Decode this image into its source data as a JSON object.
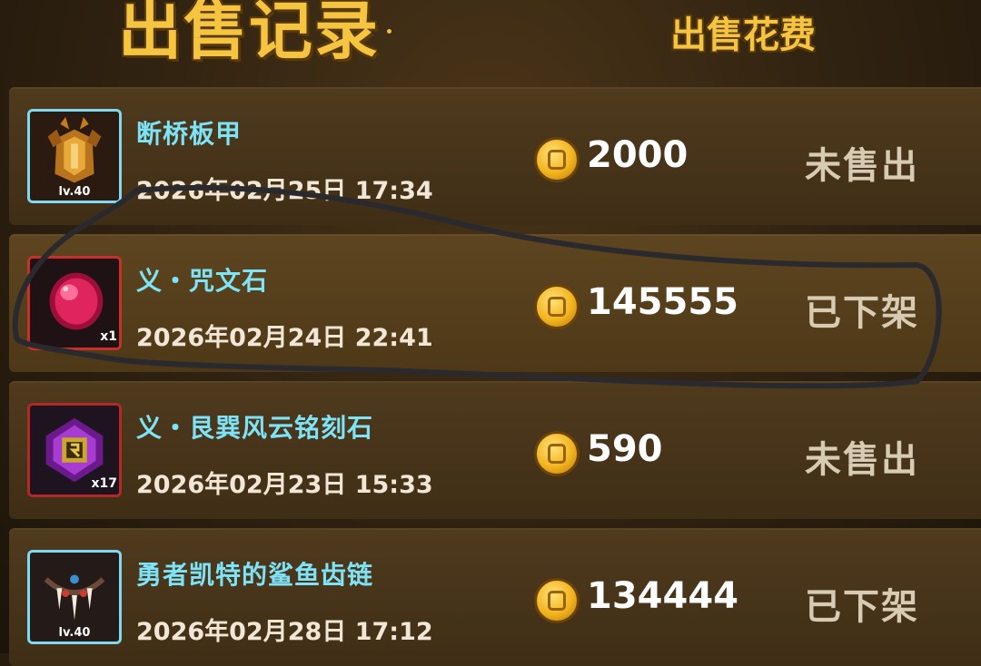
{
  "header": {
    "title": "出售记录",
    "price_column": "出售花费"
  },
  "rows": [
    {
      "name": "断桥板甲",
      "date": "2026年02月25日 17:34",
      "price": "2000",
      "status": "未售出",
      "badge": "lv.40",
      "icon": "armor-icon",
      "frame_color": "#7fd9f0"
    },
    {
      "name": "义・咒文石",
      "date": "2026年02月24日 22:41",
      "price": "145555",
      "status": "已下架",
      "badge": "x1",
      "icon": "ruby-gem-icon",
      "frame_color": "#c8302c"
    },
    {
      "name": "义・艮巽风云铭刻石",
      "date": "2026年02月23日 15:33",
      "price": "590",
      "status": "未售出",
      "badge": "x17",
      "icon": "purple-rune-stone-icon",
      "frame_color": "#b52828"
    },
    {
      "name": "勇者凯特的鲨鱼齿链",
      "date": "2026年02月28日 17:12",
      "price": "134444",
      "status": "已下架",
      "badge": "lv.40",
      "icon": "shark-tooth-necklace-icon",
      "frame_color": "#7fd9f0"
    }
  ],
  "colors": {
    "gold_title": "#f5c542",
    "item_name": "#7fe3f7",
    "status_text": "#d8cbb4"
  }
}
